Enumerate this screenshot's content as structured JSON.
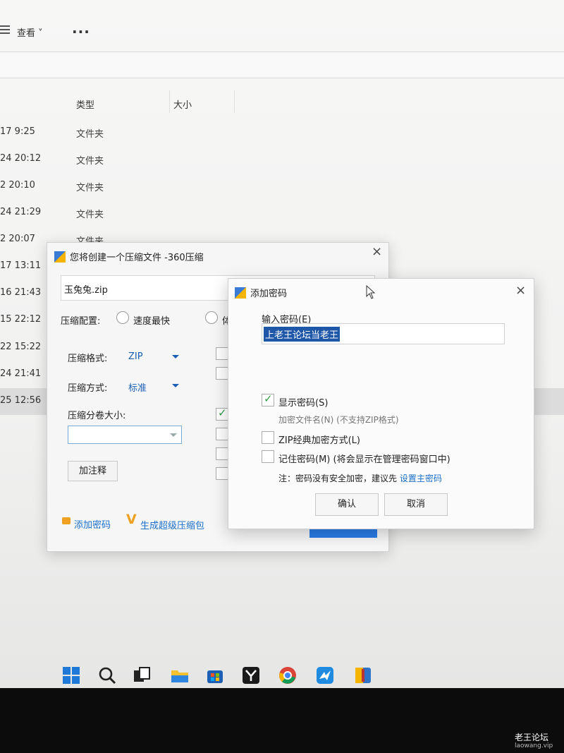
{
  "explorer": {
    "view_label": "查看 ˅",
    "more_label": "...",
    "col_type": "类型",
    "col_size": "大小",
    "rows": [
      {
        "date": "17 9:25",
        "type": "文件夹"
      },
      {
        "date": "24 20:12",
        "type": "文件夹"
      },
      {
        "date": "2 20:10",
        "type": "文件夹"
      },
      {
        "date": "24 21:29",
        "type": "文件夹"
      },
      {
        "date": "2 20:07",
        "type": "文件夹"
      },
      {
        "date": "17 13:11",
        "type": ""
      },
      {
        "date": "16 21:43",
        "type": ""
      },
      {
        "date": "15 22:12",
        "type": ""
      },
      {
        "date": "22 15:22",
        "type": ""
      },
      {
        "date": "24 21:41",
        "type": ""
      },
      {
        "date": "25 12:56",
        "type": ""
      }
    ]
  },
  "compress_dialog": {
    "title": "您将创建一个压缩文件 -360压缩",
    "filename": "玉兔兔.zip",
    "config_label": "压缩配置:",
    "option_fast": "速度最快",
    "option_partial": "体",
    "format_label": "压缩格式:",
    "format_value": "ZIP",
    "method_label": "压缩方式:",
    "method_value": "标准",
    "volume_label": "压缩分卷大小:",
    "comment_button": "加注释",
    "add_password_link": "添加密码",
    "super_pack_link": "生成超级压缩包",
    "close_icon": "×"
  },
  "password_dialog": {
    "title": "添加密码",
    "close_icon": "×",
    "input_label": "输入密码(E)",
    "password_value": "上老王论坛当老王",
    "show_password": "显示密码(S)",
    "show_password_checked": true,
    "encrypt_filename": "加密文件名(N) (不支持ZIP格式)",
    "zip_classic": "ZIP经典加密方式(L)",
    "remember": "记住密码(M) (将会显示在管理密码窗口中)",
    "note_prefix": "注：密码没有安全加密，建议先 ",
    "note_link": "设置主密码",
    "ok_button": "确认",
    "cancel_button": "取消"
  },
  "taskbar": {
    "icons": [
      "windows-start-icon",
      "search-icon",
      "task-view-icon",
      "file-explorer-icon",
      "store-icon",
      "app-y-icon",
      "chrome-icon",
      "bird-app-icon",
      "360zip-icon"
    ]
  },
  "watermark": {
    "line1": "老王论坛",
    "line2": "laowang.vip"
  }
}
